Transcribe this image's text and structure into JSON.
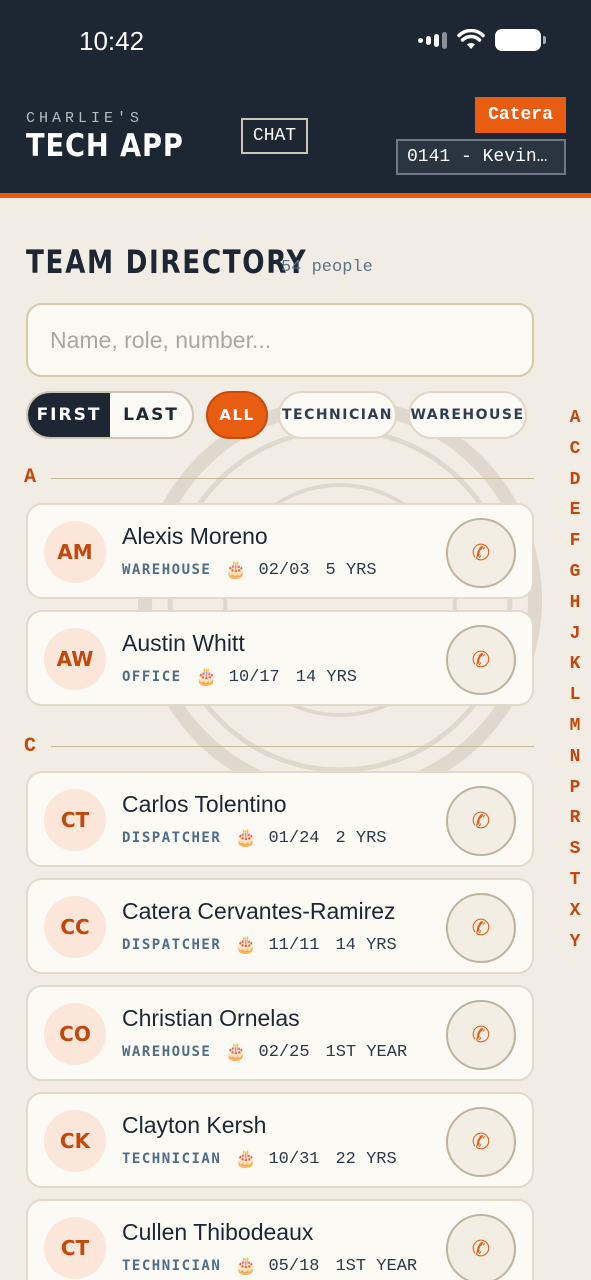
{
  "status_bar": {
    "time": "10:42"
  },
  "header": {
    "brand_small": "CHARLIE'S",
    "brand_big": "TECH APP",
    "chat_label": "CHAT",
    "user_label": "Catera",
    "store_value": "0141 - Kevin…"
  },
  "directory": {
    "title": "TEAM DIRECTORY",
    "count": "54 people",
    "search_placeholder": "Name, role, number...",
    "sort": {
      "first": "FIRST",
      "last": "LAST",
      "active": "first"
    },
    "filters": {
      "all": "ALL",
      "technician": "TECHNICIAN",
      "warehouse": "WAREHOUSE",
      "active": "all"
    },
    "sections": [
      {
        "letter": "A",
        "people": [
          {
            "initials": "AM",
            "name": "Alexis Moreno",
            "role": "WAREHOUSE",
            "birthday": "02/03",
            "tenure": "5 YRS"
          },
          {
            "initials": "AW",
            "name": "Austin Whitt",
            "role": "OFFICE",
            "birthday": "10/17",
            "tenure": "14 YRS"
          }
        ]
      },
      {
        "letter": "C",
        "people": [
          {
            "initials": "CT",
            "name": "Carlos Tolentino",
            "role": "DISPATCHER",
            "birthday": "01/24",
            "tenure": "2 YRS"
          },
          {
            "initials": "CC",
            "name": "Catera Cervantes-Ramirez",
            "role": "DISPATCHER",
            "birthday": "11/11",
            "tenure": "14 YRS"
          },
          {
            "initials": "CO",
            "name": "Christian Ornelas",
            "role": "WAREHOUSE",
            "birthday": "02/25",
            "tenure": "1ST YEAR"
          },
          {
            "initials": "CK",
            "name": "Clayton Kersh",
            "role": "TECHNICIAN",
            "birthday": "10/31",
            "tenure": "22 YRS"
          },
          {
            "initials": "CT",
            "name": "Cullen Thibodeaux",
            "role": "TECHNICIAN",
            "birthday": "05/18",
            "tenure": "1ST YEAR"
          }
        ]
      }
    ],
    "alphabet": [
      "A",
      "C",
      "D",
      "E",
      "F",
      "G",
      "H",
      "J",
      "K",
      "L",
      "M",
      "N",
      "P",
      "R",
      "S",
      "T",
      "X",
      "Y"
    ]
  },
  "icons": {
    "call": "phone-icon",
    "birthday": "cake-icon"
  },
  "colors": {
    "navy": "#1c2733",
    "orange": "#e85d12",
    "background": "#f2ede4"
  }
}
